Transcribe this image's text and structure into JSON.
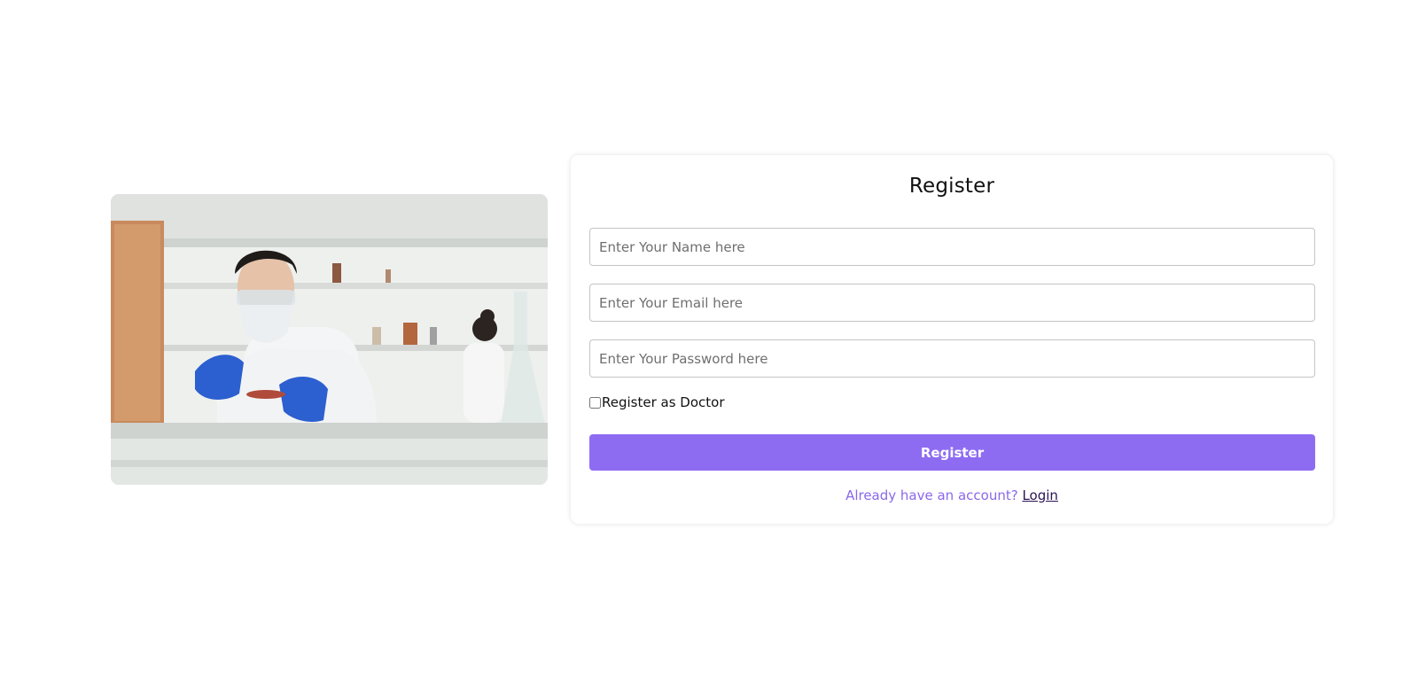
{
  "image": {
    "alt": "",
    "icon": "lab-scientist-photo"
  },
  "register": {
    "title": "Register",
    "fields": {
      "name_placeholder": "Enter Your Name here",
      "email_placeholder": "Enter Your Email here",
      "password_placeholder": "Enter Your Password here"
    },
    "doctor_checkbox_label": "Register as Doctor",
    "doctor_checked": false,
    "submit_label": "Register",
    "login_prompt": "Already have an account?",
    "login_link": "Login"
  },
  "colors": {
    "accent": "#8e6cf2",
    "prompt_text": "#8a68ea",
    "link_text": "#2a1454"
  }
}
